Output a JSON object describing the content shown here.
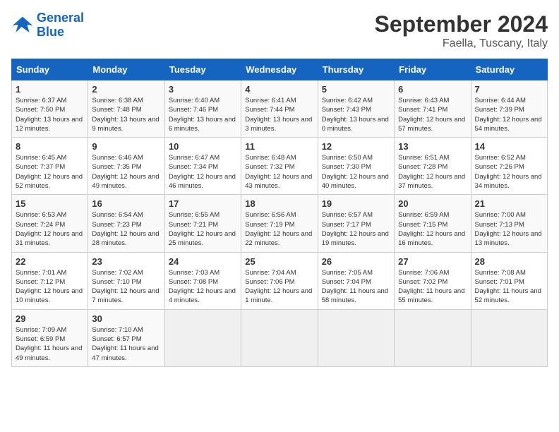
{
  "logo": {
    "line1": "General",
    "line2": "Blue"
  },
  "header": {
    "month": "September 2024",
    "location": "Faella, Tuscany, Italy"
  },
  "weekdays": [
    "Sunday",
    "Monday",
    "Tuesday",
    "Wednesday",
    "Thursday",
    "Friday",
    "Saturday"
  ],
  "weeks": [
    [
      {
        "day": "1",
        "sunrise": "Sunrise: 6:37 AM",
        "sunset": "Sunset: 7:50 PM",
        "daylight": "Daylight: 13 hours and 12 minutes."
      },
      {
        "day": "2",
        "sunrise": "Sunrise: 6:38 AM",
        "sunset": "Sunset: 7:48 PM",
        "daylight": "Daylight: 13 hours and 9 minutes."
      },
      {
        "day": "3",
        "sunrise": "Sunrise: 6:40 AM",
        "sunset": "Sunset: 7:46 PM",
        "daylight": "Daylight: 13 hours and 6 minutes."
      },
      {
        "day": "4",
        "sunrise": "Sunrise: 6:41 AM",
        "sunset": "Sunset: 7:44 PM",
        "daylight": "Daylight: 13 hours and 3 minutes."
      },
      {
        "day": "5",
        "sunrise": "Sunrise: 6:42 AM",
        "sunset": "Sunset: 7:43 PM",
        "daylight": "Daylight: 13 hours and 0 minutes."
      },
      {
        "day": "6",
        "sunrise": "Sunrise: 6:43 AM",
        "sunset": "Sunset: 7:41 PM",
        "daylight": "Daylight: 12 hours and 57 minutes."
      },
      {
        "day": "7",
        "sunrise": "Sunrise: 6:44 AM",
        "sunset": "Sunset: 7:39 PM",
        "daylight": "Daylight: 12 hours and 54 minutes."
      }
    ],
    [
      {
        "day": "8",
        "sunrise": "Sunrise: 6:45 AM",
        "sunset": "Sunset: 7:37 PM",
        "daylight": "Daylight: 12 hours and 52 minutes."
      },
      {
        "day": "9",
        "sunrise": "Sunrise: 6:46 AM",
        "sunset": "Sunset: 7:35 PM",
        "daylight": "Daylight: 12 hours and 49 minutes."
      },
      {
        "day": "10",
        "sunrise": "Sunrise: 6:47 AM",
        "sunset": "Sunset: 7:34 PM",
        "daylight": "Daylight: 12 hours and 46 minutes."
      },
      {
        "day": "11",
        "sunrise": "Sunrise: 6:48 AM",
        "sunset": "Sunset: 7:32 PM",
        "daylight": "Daylight: 12 hours and 43 minutes."
      },
      {
        "day": "12",
        "sunrise": "Sunrise: 6:50 AM",
        "sunset": "Sunset: 7:30 PM",
        "daylight": "Daylight: 12 hours and 40 minutes."
      },
      {
        "day": "13",
        "sunrise": "Sunrise: 6:51 AM",
        "sunset": "Sunset: 7:28 PM",
        "daylight": "Daylight: 12 hours and 37 minutes."
      },
      {
        "day": "14",
        "sunrise": "Sunrise: 6:52 AM",
        "sunset": "Sunset: 7:26 PM",
        "daylight": "Daylight: 12 hours and 34 minutes."
      }
    ],
    [
      {
        "day": "15",
        "sunrise": "Sunrise: 6:53 AM",
        "sunset": "Sunset: 7:24 PM",
        "daylight": "Daylight: 12 hours and 31 minutes."
      },
      {
        "day": "16",
        "sunrise": "Sunrise: 6:54 AM",
        "sunset": "Sunset: 7:23 PM",
        "daylight": "Daylight: 12 hours and 28 minutes."
      },
      {
        "day": "17",
        "sunrise": "Sunrise: 6:55 AM",
        "sunset": "Sunset: 7:21 PM",
        "daylight": "Daylight: 12 hours and 25 minutes."
      },
      {
        "day": "18",
        "sunrise": "Sunrise: 6:56 AM",
        "sunset": "Sunset: 7:19 PM",
        "daylight": "Daylight: 12 hours and 22 minutes."
      },
      {
        "day": "19",
        "sunrise": "Sunrise: 6:57 AM",
        "sunset": "Sunset: 7:17 PM",
        "daylight": "Daylight: 12 hours and 19 minutes."
      },
      {
        "day": "20",
        "sunrise": "Sunrise: 6:59 AM",
        "sunset": "Sunset: 7:15 PM",
        "daylight": "Daylight: 12 hours and 16 minutes."
      },
      {
        "day": "21",
        "sunrise": "Sunrise: 7:00 AM",
        "sunset": "Sunset: 7:13 PM",
        "daylight": "Daylight: 12 hours and 13 minutes."
      }
    ],
    [
      {
        "day": "22",
        "sunrise": "Sunrise: 7:01 AM",
        "sunset": "Sunset: 7:12 PM",
        "daylight": "Daylight: 12 hours and 10 minutes."
      },
      {
        "day": "23",
        "sunrise": "Sunrise: 7:02 AM",
        "sunset": "Sunset: 7:10 PM",
        "daylight": "Daylight: 12 hours and 7 minutes."
      },
      {
        "day": "24",
        "sunrise": "Sunrise: 7:03 AM",
        "sunset": "Sunset: 7:08 PM",
        "daylight": "Daylight: 12 hours and 4 minutes."
      },
      {
        "day": "25",
        "sunrise": "Sunrise: 7:04 AM",
        "sunset": "Sunset: 7:06 PM",
        "daylight": "Daylight: 12 hours and 1 minute."
      },
      {
        "day": "26",
        "sunrise": "Sunrise: 7:05 AM",
        "sunset": "Sunset: 7:04 PM",
        "daylight": "Daylight: 11 hours and 58 minutes."
      },
      {
        "day": "27",
        "sunrise": "Sunrise: 7:06 AM",
        "sunset": "Sunset: 7:02 PM",
        "daylight": "Daylight: 11 hours and 55 minutes."
      },
      {
        "day": "28",
        "sunrise": "Sunrise: 7:08 AM",
        "sunset": "Sunset: 7:01 PM",
        "daylight": "Daylight: 11 hours and 52 minutes."
      }
    ],
    [
      {
        "day": "29",
        "sunrise": "Sunrise: 7:09 AM",
        "sunset": "Sunset: 6:59 PM",
        "daylight": "Daylight: 11 hours and 49 minutes."
      },
      {
        "day": "30",
        "sunrise": "Sunrise: 7:10 AM",
        "sunset": "Sunset: 6:57 PM",
        "daylight": "Daylight: 11 hours and 47 minutes."
      },
      {
        "day": "",
        "sunrise": "",
        "sunset": "",
        "daylight": ""
      },
      {
        "day": "",
        "sunrise": "",
        "sunset": "",
        "daylight": ""
      },
      {
        "day": "",
        "sunrise": "",
        "sunset": "",
        "daylight": ""
      },
      {
        "day": "",
        "sunrise": "",
        "sunset": "",
        "daylight": ""
      },
      {
        "day": "",
        "sunrise": "",
        "sunset": "",
        "daylight": ""
      }
    ]
  ]
}
